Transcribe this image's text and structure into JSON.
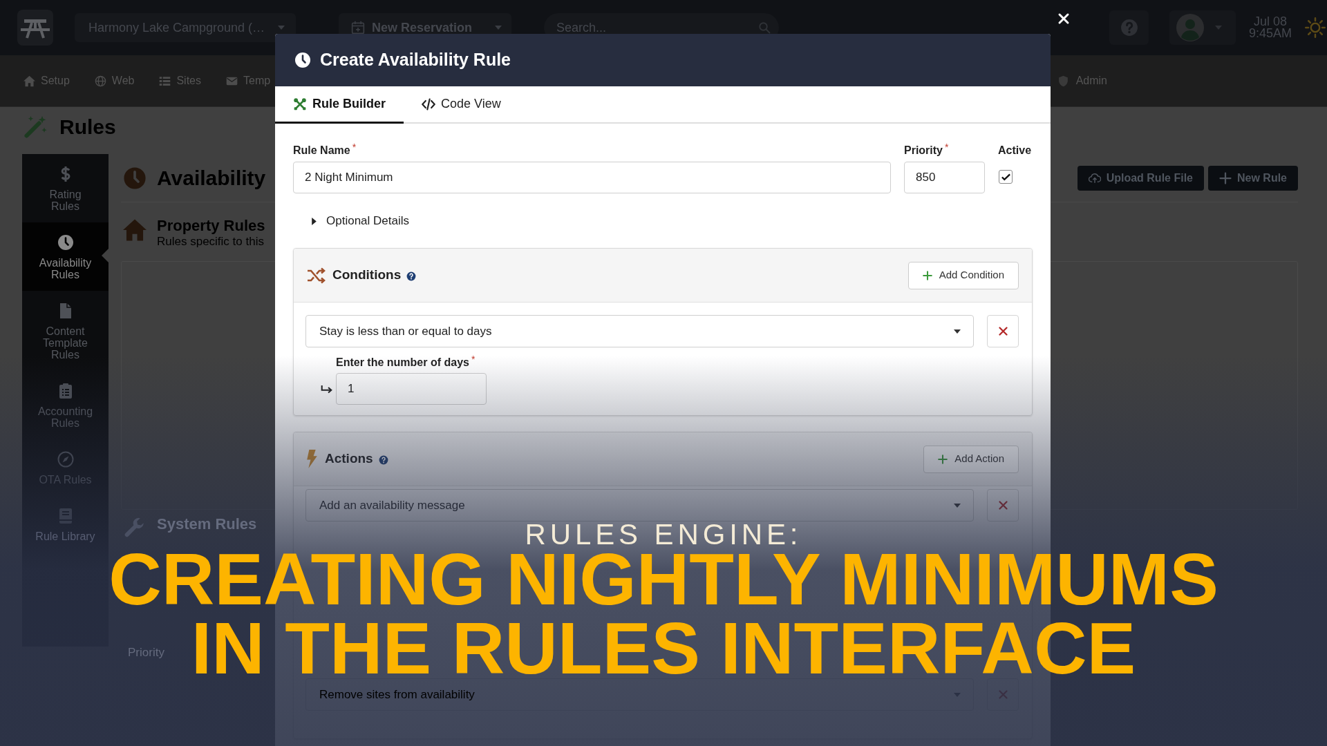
{
  "top_bar": {
    "property_select": "Harmony Lake Campground (…",
    "new_reservation": "New Reservation",
    "search": {
      "placeholder": "Search..."
    },
    "date": "Jul 08",
    "time": "9:45AM"
  },
  "nav": {
    "items": [
      {
        "label": "Setup"
      },
      {
        "label": "Web"
      },
      {
        "label": "Sites"
      },
      {
        "label": "Temp"
      }
    ],
    "admin": "Admin"
  },
  "page": {
    "title": "Rules"
  },
  "sidebar": {
    "items": [
      {
        "label": "Rating\nRules",
        "selected": false
      },
      {
        "label": "Availability\nRules",
        "selected": true
      },
      {
        "label": "Content\nTemplate\nRules",
        "selected": false
      },
      {
        "label": "Accounting\nRules",
        "selected": false
      },
      {
        "label": "OTA Rules",
        "selected": false
      },
      {
        "label": "Rule Library",
        "selected": false
      }
    ]
  },
  "content": {
    "title": "Availability",
    "buttons": [
      "Upload Rule File",
      "New Rule"
    ],
    "sections": [
      {
        "title": "Property Rules",
        "subtitle": "Rules specific to this"
      },
      {
        "title": "System Rules",
        "column_1": "Priority"
      }
    ]
  },
  "modal": {
    "title": "Create Availability Rule",
    "tabs": [
      {
        "label": "Rule Builder",
        "selected": true
      },
      {
        "label": "Code View",
        "selected": false
      }
    ],
    "rule_name": {
      "label": "Rule Name",
      "required_mark": "*",
      "value": "2 Night Minimum"
    },
    "priority": {
      "label": "Priority",
      "required_mark": "*",
      "value": "850"
    },
    "active": {
      "label": "Active",
      "checked": true
    },
    "optional_details": {
      "label": "Optional Details",
      "expanded": false
    },
    "conditions": {
      "title": "Conditions",
      "add_button": "Add Condition",
      "rows": [
        {
          "selection": "Stay is less than or equal to days",
          "parameter": {
            "kind": "number",
            "label": "Enter the number of days",
            "required_mark": "*",
            "value": "1"
          }
        }
      ]
    },
    "actions": {
      "title": "Actions",
      "add_button": "Add Action",
      "rows": [
        {
          "selection": "Add an availability message"
        },
        {
          "selection": "Remove sites from availability"
        }
      ]
    }
  },
  "overlay_title": {
    "kicker": "RULES ENGINE:",
    "lines": [
      "CREATING NIGHTLY MINIMUMS",
      "IN THE RULES INTERFACE"
    ]
  }
}
